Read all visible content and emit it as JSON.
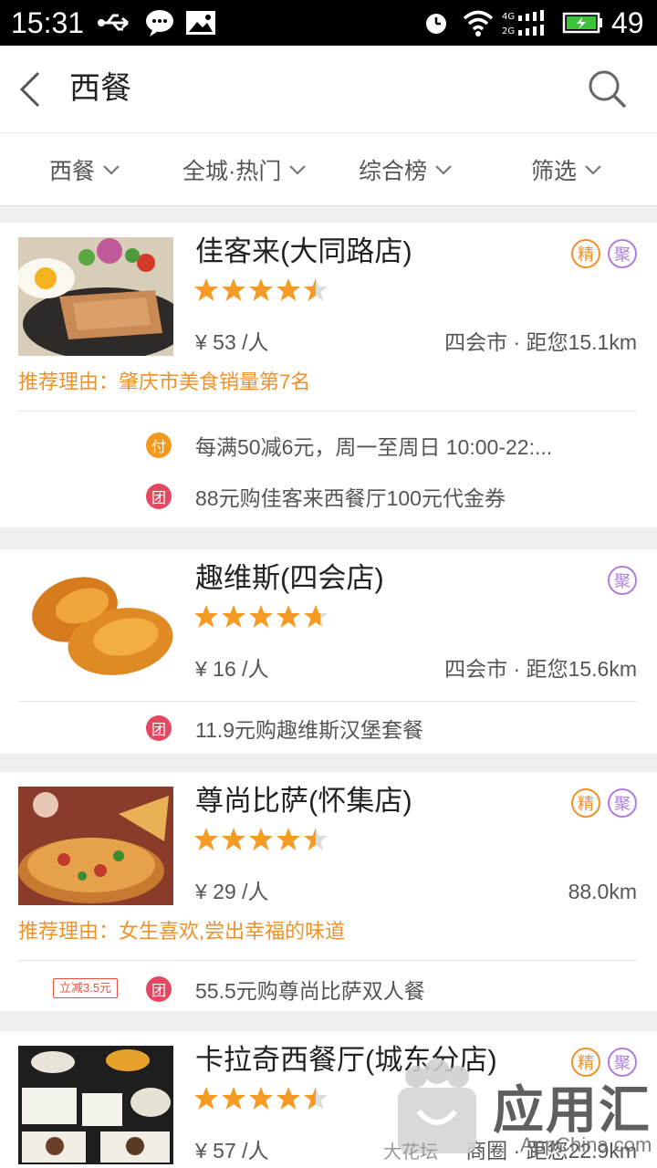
{
  "status_bar": {
    "time": "15:31",
    "battery": "49",
    "icons": [
      "usb-icon",
      "wechat-icon",
      "image-icon",
      "alarm-icon",
      "wifi-icon",
      "signal-icon",
      "battery-icon"
    ]
  },
  "header": {
    "title": "西餐",
    "back_icon": "chevron-left-icon",
    "search_icon": "search-icon"
  },
  "filters": [
    {
      "label": "西餐"
    },
    {
      "label": "全城·热门"
    },
    {
      "label": "综合榜"
    },
    {
      "label": "筛选"
    }
  ],
  "colors": {
    "accent": "#f0912a",
    "star": "#f59a23",
    "ju_badge": "#b07ee0",
    "pay_icon": "#f39a1e",
    "group_icon": "#e2485f"
  },
  "restaurants": [
    {
      "name": "佳客来(大同路店)",
      "rating": 4.5,
      "price": "¥ 53 /人",
      "distance": "四会市 · 距您15.1km",
      "reason": "推荐理由：肇庆市美食销量第7名",
      "badges": [
        "精",
        "聚"
      ],
      "promos": [
        {
          "icon": "付",
          "text": "每满50减6元，周一至周日 10:00-22:..."
        },
        {
          "icon": "团",
          "text": "88元购佳客来西餐厅100元代金券"
        }
      ]
    },
    {
      "name": "趣维斯(四会店)",
      "rating": 4.7,
      "price": "¥ 16 /人",
      "distance": "四会市 · 距您15.6km",
      "badges": [
        "聚"
      ],
      "promos": [
        {
          "icon": "团",
          "text": "11.9元购趣维斯汉堡套餐"
        }
      ]
    },
    {
      "name": "尊尚比萨(怀集店)",
      "rating": 4.5,
      "price": "¥ 29 /人",
      "distance": "88.0km",
      "reason": "推荐理由：女生喜欢,尝出幸福的味道",
      "badges": [
        "精",
        "聚"
      ],
      "promos": [
        {
          "tag": "立减3.5元",
          "icon": "团",
          "text": "55.5元购尊尚比萨双人餐"
        }
      ]
    },
    {
      "name": "卡拉奇西餐厅(城东分店)",
      "rating": 4.5,
      "price": "¥ 57 /人",
      "distance": "商圈 · 距您22.9km",
      "badges": [
        "精",
        "聚"
      ]
    }
  ],
  "watermark": {
    "brand": "应用汇",
    "sub": "大花坛",
    "url": "AppChina.com"
  }
}
